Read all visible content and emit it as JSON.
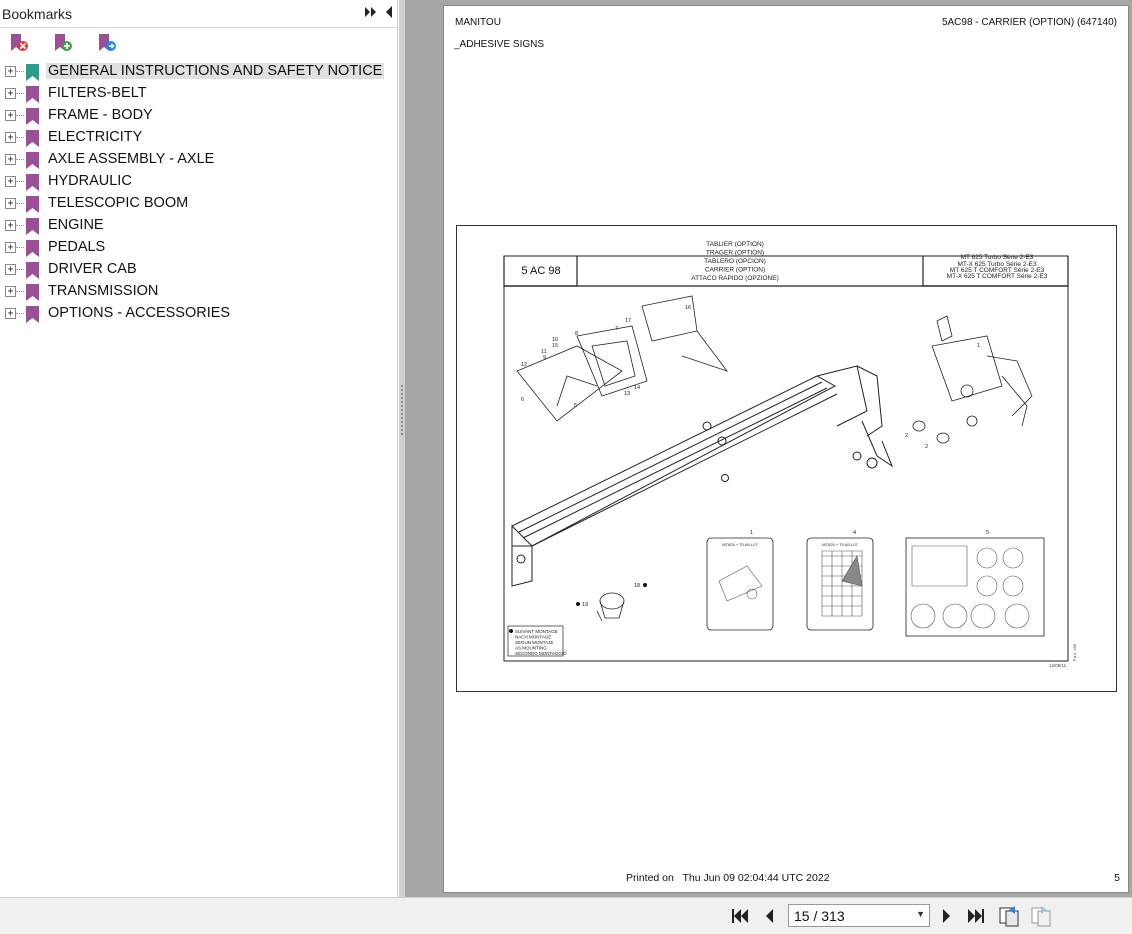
{
  "bookmarks_panel": {
    "title": "Bookmarks",
    "collapse_all_icon": "double-arrow-right-icon",
    "close_panel_icon": "triangle-left-icon",
    "toolbar": [
      {
        "name": "delete-bookmark-icon",
        "icon": "bookmark-delete"
      },
      {
        "name": "add-bookmark-icon",
        "icon": "bookmark-add"
      },
      {
        "name": "find-bookmark-icon",
        "icon": "bookmark-find"
      }
    ],
    "items": [
      {
        "label": "GENERAL INSTRUCTIONS AND SAFETY NOTICE",
        "selected": true,
        "color": "#2a9d8f"
      },
      {
        "label": "FILTERS-BELT",
        "selected": false,
        "color": "#9b4f96"
      },
      {
        "label": "FRAME - BODY",
        "selected": false,
        "color": "#9b4f96"
      },
      {
        "label": "ELECTRICITY",
        "selected": false,
        "color": "#9b4f96"
      },
      {
        "label": "AXLE ASSEMBLY - AXLE",
        "selected": false,
        "color": "#9b4f96"
      },
      {
        "label": "HYDRAULIC",
        "selected": false,
        "color": "#9b4f96"
      },
      {
        "label": "TELESCOPIC BOOM",
        "selected": false,
        "color": "#9b4f96"
      },
      {
        "label": "ENGINE",
        "selected": false,
        "color": "#9b4f96"
      },
      {
        "label": "PEDALS",
        "selected": false,
        "color": "#9b4f96"
      },
      {
        "label": "DRIVER CAB",
        "selected": false,
        "color": "#9b4f96"
      },
      {
        "label": "TRANSMISSION",
        "selected": false,
        "color": "#9b4f96"
      },
      {
        "label": "OPTIONS - ACCESSORIES",
        "selected": false,
        "color": "#9b4f96"
      }
    ]
  },
  "document": {
    "header_left": "MANITOU",
    "header_right": "5AC98 - CARRIER (OPTION) (647140)",
    "section": "_ADHESIVE SIGNS",
    "figure": {
      "code": "5 AC 98",
      "titles": [
        "TABLIER (OPTION)",
        "TRAGER (OPTION)",
        "TABLERO (OPCION)",
        "CARRIER (OPTION)",
        "ATTACO RAPIDO (OPZIONE)"
      ],
      "models": [
        "MT 625 Turbo Série 2-E3",
        "MT-X 625 Turbo Série 2-E3",
        "MT 625 T COMFORT Série 2-E3",
        "MT-X 625 T COMFORT Série 2-E3"
      ],
      "mounting_note": [
        "SUIVANT MONTAGE",
        "NACH MONTAGE",
        "SEGUN MONTAJE",
        "AS MOUNTING",
        "SECONDO MONTAGGIO"
      ],
      "date_code": "12/09/11",
      "ref_code": "P.A.S. 03/E",
      "decal_1_header": "MT625 + T0.A0.L07",
      "decal_4_header": "MT625 + T0.A0.L07",
      "callouts": [
        "16",
        "17",
        "8",
        "7",
        "10",
        "15",
        "11",
        "9",
        "12",
        "6",
        "5",
        "13",
        "14",
        "1",
        "2",
        "2",
        "1",
        "4",
        "5",
        "19",
        "18"
      ]
    },
    "printed_label": "Printed on",
    "printed_date": "Thu Jun 09 02:04:44 UTC 2022",
    "page_number": "5"
  },
  "navigation": {
    "page_display": "15 / 313",
    "buttons": [
      "first-page-icon",
      "prev-page-icon",
      "next-page-icon",
      "last-page-icon",
      "prev-view-icon",
      "next-view-icon"
    ]
  }
}
